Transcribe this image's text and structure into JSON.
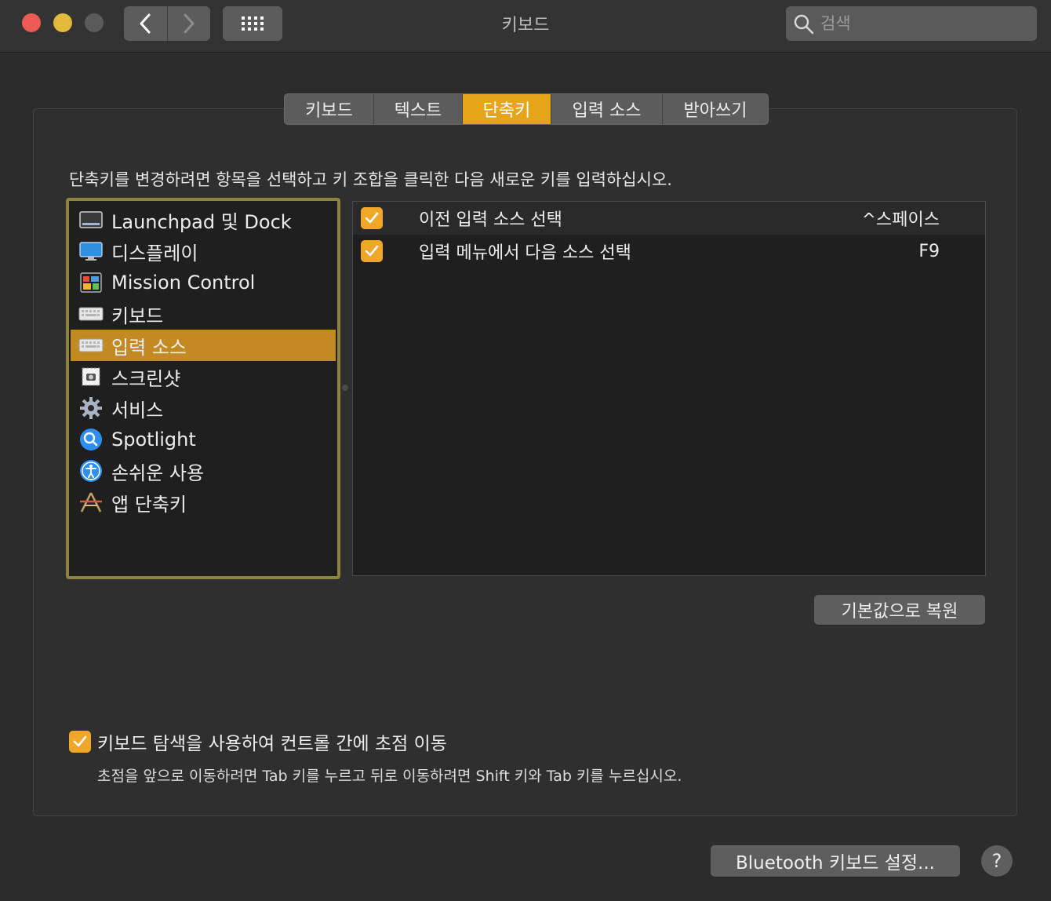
{
  "window": {
    "title": "키보드"
  },
  "search": {
    "placeholder": "검색"
  },
  "tabs": [
    {
      "label": "키보드",
      "active": false
    },
    {
      "label": "텍스트",
      "active": false
    },
    {
      "label": "단축키",
      "active": true
    },
    {
      "label": "입력 소스",
      "active": false
    },
    {
      "label": "받아쓰기",
      "active": false
    }
  ],
  "instruction": "단축키를 변경하려면 항목을 선택하고 키 조합을 클릭한 다음 새로운 키를 입력하십시오.",
  "categories": [
    {
      "label": "Launchpad 및 Dock",
      "icon": "launchpad-dock-icon"
    },
    {
      "label": "디스플레이",
      "icon": "display-icon"
    },
    {
      "label": "Mission Control",
      "icon": "mission-control-icon"
    },
    {
      "label": "키보드",
      "icon": "keyboard-icon"
    },
    {
      "label": "입력 소스",
      "icon": "keyboard-icon",
      "selected": true
    },
    {
      "label": "스크린샷",
      "icon": "screenshot-icon"
    },
    {
      "label": "서비스",
      "icon": "gear-icon"
    },
    {
      "label": "Spotlight",
      "icon": "spotlight-search-icon"
    },
    {
      "label": "손쉬운 사용",
      "icon": "accessibility-icon"
    },
    {
      "label": "앱 단축키",
      "icon": "app-shortcuts-icon"
    }
  ],
  "shortcuts": [
    {
      "label": "이전 입력 소스 선택",
      "key": "^스페이스",
      "checked": true
    },
    {
      "label": "입력 메뉴에서 다음 소스 선택",
      "key": "F9",
      "checked": true
    }
  ],
  "buttons": {
    "restore": "기본값으로 복원",
    "bluetooth": "Bluetooth 키보드 설정...",
    "help": "?"
  },
  "keyboard_navigation": {
    "label": "키보드 탐색을 사용하여 컨트롤 간에 초점 이동",
    "checked": true,
    "description": "초점을 앞으로 이동하려면 Tab 키를 누르고 뒤로 이동하려면 Shift 키와 Tab 키를 누르십시오."
  },
  "colors": {
    "accent": "#e6a419",
    "selection": "#c48a22",
    "focus_ring": "#8d8440"
  }
}
